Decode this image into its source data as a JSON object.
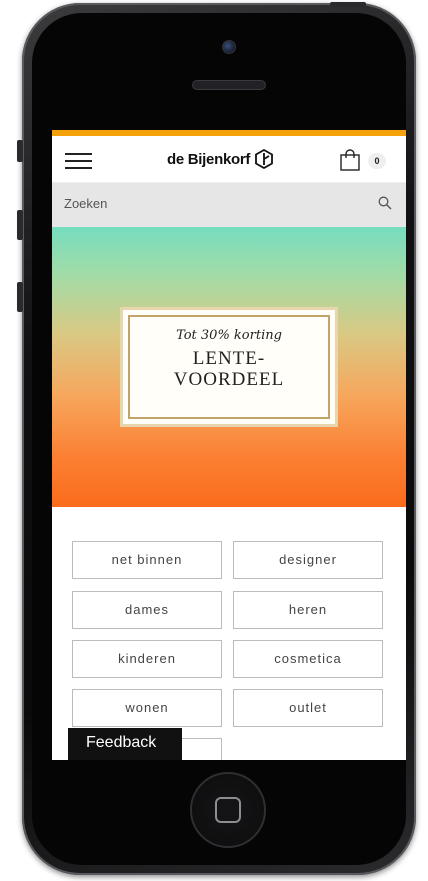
{
  "store": {
    "logo_text": "de Bijenkorf",
    "cart_count": "0"
  },
  "search": {
    "placeholder": "Zoeken"
  },
  "promo": {
    "subtitle": "Tot 30% korting",
    "title_line1": "LENTE-",
    "title_line2": "VOORDEEL"
  },
  "categories": [
    "net binnen",
    "designer",
    "dames",
    "heren",
    "kinderen",
    "cosmetica",
    "wonen",
    "outlet",
    ""
  ],
  "feedback": {
    "label": "Feedback"
  },
  "colors": {
    "accent": "#f5a10a",
    "hero_top": "#76ddc0",
    "hero_bottom": "#fb6b1c",
    "promo_border": "#c2a46b"
  },
  "icons": [
    "hamburger-icon",
    "logo-mark-icon",
    "shopping-bag-icon",
    "search-icon",
    "home-button-icon"
  ]
}
